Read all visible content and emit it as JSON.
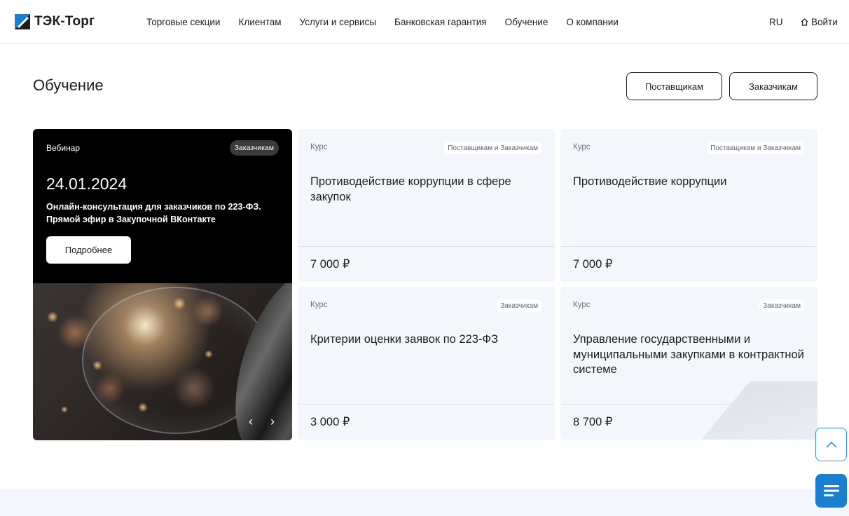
{
  "header": {
    "logo_text": "ТЭК-Торг",
    "nav": [
      {
        "label": "Торговые секции"
      },
      {
        "label": "Клиентам"
      },
      {
        "label": "Услуги и сервисы"
      },
      {
        "label": "Банковская гарантия"
      },
      {
        "label": "Обучение"
      },
      {
        "label": "О компании"
      }
    ],
    "lang": "RU",
    "login": "Войти"
  },
  "page": {
    "title": "Обучение",
    "filter_buttons": {
      "suppliers": "Поставщикам",
      "customers": "Заказчикам"
    }
  },
  "webinar": {
    "type": "Вебинар",
    "badge": "Заказчикам",
    "date": "24.01.2024",
    "description": "Онлайн-консультация для заказчиков по 223-ФЗ. Прямой эфир в Закупочной ВКонтакте",
    "more_button": "Подробнее",
    "prev_icon": "‹",
    "next_icon": "›"
  },
  "courses": [
    {
      "type": "Курс",
      "audience": "Поставщикам и Заказчикам",
      "title": "Противодействие коррупции в сфере закупок",
      "price": "7 000 ₽"
    },
    {
      "type": "Курс",
      "audience": "Поставщикам и Заказчикам",
      "title": "Противодействие коррупции",
      "price": "7 000 ₽"
    },
    {
      "type": "Курс",
      "audience": "Заказчикам",
      "title": "Критерии оценки заявок по 223-ФЗ",
      "price": "3 000 ₽"
    },
    {
      "type": "Курс",
      "audience": "Заказчикам",
      "title": "Управление государственными и муниципальными закупками в контрактной системе",
      "price": "8 700 ₽"
    }
  ],
  "colors": {
    "accent": "#1a7ed1",
    "card_bg": "#f3f7fb",
    "text": "#1d1d1b"
  }
}
